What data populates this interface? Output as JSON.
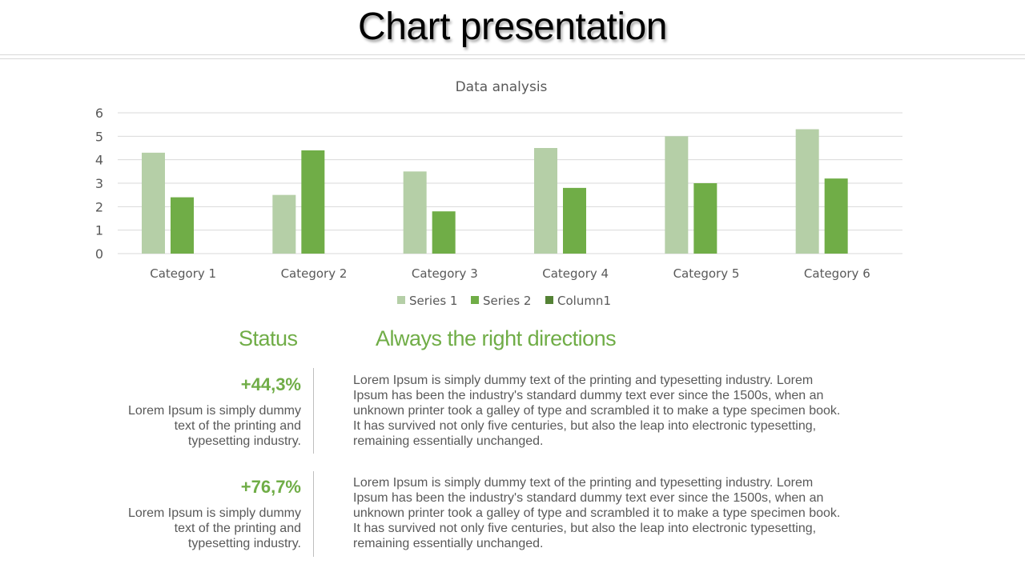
{
  "page": {
    "title": "Chart presentation"
  },
  "chart_data": {
    "type": "bar",
    "title": "Data analysis",
    "xlabel": "",
    "ylabel": "",
    "ylim": [
      0,
      6
    ],
    "yticks": [
      0,
      1,
      2,
      3,
      4,
      5,
      6
    ],
    "grid": true,
    "legend_position": "bottom",
    "categories": [
      "Category 1",
      "Category 2",
      "Category 3",
      "Category 4",
      "Category 5",
      "Category 6"
    ],
    "series": [
      {
        "name": "Series 1",
        "color": "#b5cfa7",
        "values": [
          4.3,
          2.5,
          3.5,
          4.5,
          5.0,
          5.3
        ]
      },
      {
        "name": "Series 2",
        "color": "#70ad47",
        "values": [
          2.4,
          4.4,
          1.8,
          2.8,
          3.0,
          3.2
        ]
      },
      {
        "name": "Column1",
        "color": "#548235",
        "values": [
          null,
          null,
          null,
          null,
          null,
          null
        ]
      }
    ]
  },
  "sections": {
    "status_heading": "Status",
    "directions_heading": "Always the right directions"
  },
  "stats": [
    {
      "value": "+44,3%",
      "description": "Lorem Ipsum is simply dummy text of the printing and typesetting industry.",
      "paragraph": "Lorem Ipsum is simply dummy text of the printing and typesetting industry. Lorem Ipsum has been the industry's standard dummy text ever since the 1500s, when an unknown printer took a galley of type and scrambled it to make a type specimen book. It has survived not only five centuries, but also the leap into electronic typesetting, remaining essentially unchanged."
    },
    {
      "value": "+76,7%",
      "description": "Lorem Ipsum is simply dummy text of the printing and typesetting industry.",
      "paragraph": "Lorem Ipsum is simply dummy text of the printing and typesetting industry. Lorem Ipsum has been the industry's standard dummy text ever since the 1500s, when an unknown printer took a galley of type and scrambled it to make a type specimen book. It has survived not only five centuries, but also the leap into electronic typesetting, remaining essentially unchanged."
    }
  ]
}
